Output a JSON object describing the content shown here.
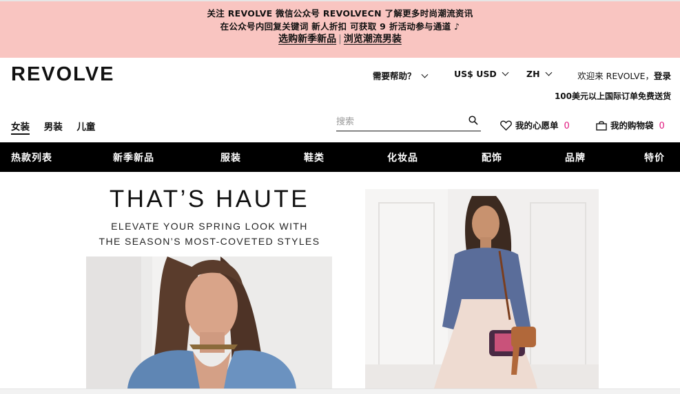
{
  "promo": {
    "line1": "关注 REVOLVE 微信公众号 REVOLVECN 了解更多时尚潮流资讯",
    "line2": "在公众号内回复关键词 新人折扣 可获取 9 折活动参与通道 ♪",
    "link_new": "选购新季新品",
    "separator": "|",
    "link_men": "浏览潮流男装"
  },
  "header": {
    "logo": "REVOLVE",
    "help": "需要帮助？",
    "currency": "US$ USD",
    "language": "ZH",
    "welcome": "欢迎来 REVOLVE，",
    "login": "登录",
    "shipping": "100美元以上国际订单免费送货"
  },
  "gender_tabs": [
    "女装",
    "男装",
    "儿童"
  ],
  "search": {
    "placeholder": "搜索"
  },
  "wishlist": {
    "label": "我的心愿单",
    "count": "0"
  },
  "bag": {
    "label": "我的购物袋",
    "count": "0"
  },
  "nav": [
    "热款列表",
    "新季新品",
    "服装",
    "鞋类",
    "化妆品",
    "配饰",
    "品牌",
    "特价"
  ],
  "hero": {
    "title": "THAT’S HAUTE",
    "sub1": "ELEVATE YOUR SPRING LOOK WITH",
    "sub2": "THE SEASON’S MOST-COVETED STYLES"
  },
  "colors": {
    "promo_bg": "#f9c5c1",
    "nav_bg": "#000000",
    "accent": "#e0177e"
  }
}
